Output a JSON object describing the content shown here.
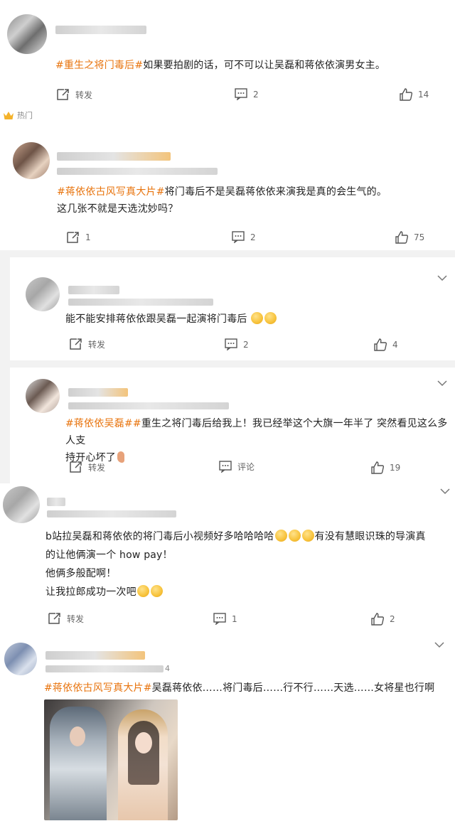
{
  "comments": [
    {
      "tag": "#重生之将门毒后#",
      "text": "如果要拍剧的话，可不可以让吴磊和蒋依依演男女主。",
      "repost_label": "转发",
      "comment_count": "2",
      "like_count": "14"
    },
    {
      "badge_label": "热门",
      "tag": "#蒋依依古风写真大片#",
      "text_line1": "将门毒后不是吴磊蒋依依来演我是真的会生气的。",
      "text_line2": "这几张不就是天选沈妙吗？",
      "repost_count": "1",
      "comment_count": "2",
      "like_count": "75"
    },
    {
      "text": "能不能安排蒋依依跟吴磊一起演将门毒后",
      "repost_label": "转发",
      "comment_count": "2",
      "like_count": "4"
    },
    {
      "tag": "#蒋依依吴磊#",
      "tag2": "重生之将门毒后",
      "text_line1": "给我上！我已经举这个大旗一年半了 突然看见这么多人支",
      "text_line2": "持开心坏了",
      "repost_label": "转发",
      "comment_label": "评论",
      "like_count": "19"
    },
    {
      "text_line1a": "b站拉吴磊和蒋依依的将门毒后小视频好多哈哈哈哈",
      "text_line1b": "有没有慧眼识珠的导演真",
      "text_line2": "的让他俩演一个 how pay！",
      "text_line3": "他俩多般配啊！",
      "text_line4": "让我拉郎成功一次吧",
      "repost_label": "转发",
      "comment_count": "1",
      "like_count": "2"
    },
    {
      "name_suffix": "4",
      "tag": "#蒋依依古风写真大片#",
      "text": "吴磊蒋依依……将门毒后……行不行……天选……女将星也行啊"
    }
  ],
  "colors": {
    "tag": "#e8740e",
    "divider": "#f2f2f2",
    "text": "#222222",
    "muted": "#666666"
  }
}
